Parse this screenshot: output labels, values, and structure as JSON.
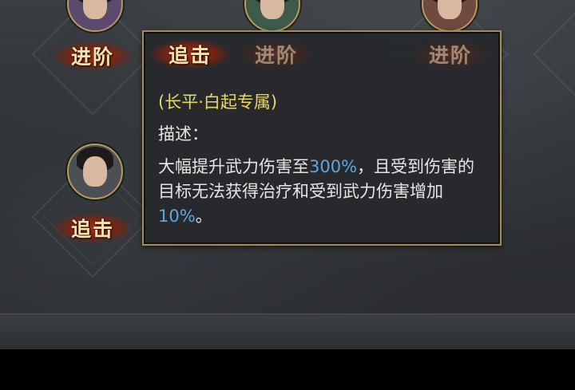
{
  "skills": {
    "advance_label": "进阶",
    "pursuit_label": "追击"
  },
  "tooltip": {
    "title": "追击",
    "faded_badge_1": "进阶",
    "faded_badge_2": "进阶",
    "subtitle": "(长平·白起专属)",
    "desc_label": "描述：",
    "desc_part1": "大幅提升武力伤害至",
    "desc_value1": "300%",
    "desc_part2": "，且受到伤害的目标无法获得治疗和受到武力伤害增加",
    "desc_value2": "10%",
    "desc_part3": "。"
  },
  "colors": {
    "highlight": "#5aa6e6",
    "subtitle": "#e9d66a",
    "border": "#a58c5c",
    "badge_red": "#aa3214"
  },
  "icons": [
    "hero-portrait-1",
    "hero-portrait-2",
    "hero-portrait-3",
    "hero-portrait-4"
  ]
}
